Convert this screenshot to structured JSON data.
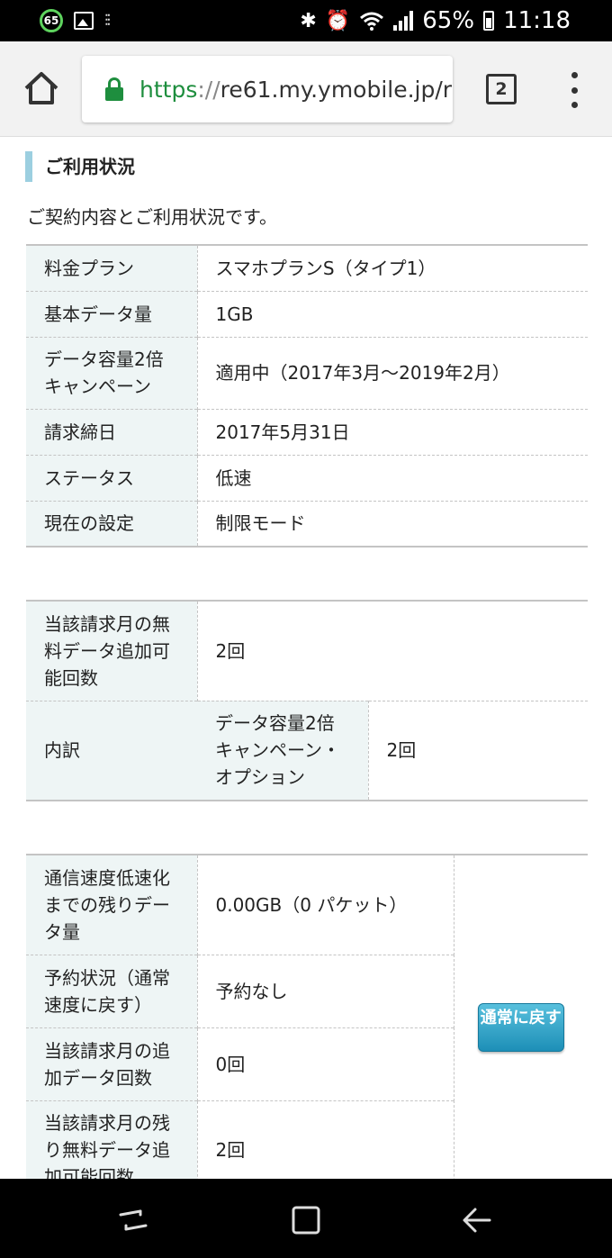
{
  "status_bar": {
    "badge": "65",
    "battery": "65%",
    "time": "11:18"
  },
  "browser": {
    "url_scheme": "https",
    "url_sep": "://",
    "url_host": "re61.my.ymobile.jp/r",
    "tab_count": "2"
  },
  "section": {
    "title": "ご利用状況",
    "intro": "ご契約内容とご利用状況です。"
  },
  "contract_table": [
    {
      "label": "料金プラン",
      "value": "スマホプランS（タイプ1）"
    },
    {
      "label": "基本データ量",
      "value": "1GB"
    },
    {
      "label": "データ容量2倍キャンペーン",
      "value": "適用中（2017年3月〜2019年2月）"
    },
    {
      "label": "請求締日",
      "value": "2017年5月31日"
    },
    {
      "label": "ステータス",
      "value": "低速"
    },
    {
      "label": "現在の設定",
      "value": "制限モード"
    }
  ],
  "free_data_table": {
    "row1": {
      "label": "当該請求月の無料データ追加可能回数",
      "value": "2回"
    },
    "row2": {
      "label": "内訳",
      "sublabel": "データ容量2倍キャンペーン・オプション",
      "value": "2回"
    }
  },
  "speed_table": [
    {
      "label": "通信速度低速化までの残りデータ量",
      "value": "0.00GB（0 パケット）"
    },
    {
      "label": "予約状況（通常速度に戻す）",
      "value": "予約なし"
    },
    {
      "label": "当該請求月の追加データ回数",
      "value": "0回"
    },
    {
      "label": "当該請求月の残り無料データ追加可能回数",
      "value": "2回"
    }
  ],
  "revert_button": "通常に戻す"
}
